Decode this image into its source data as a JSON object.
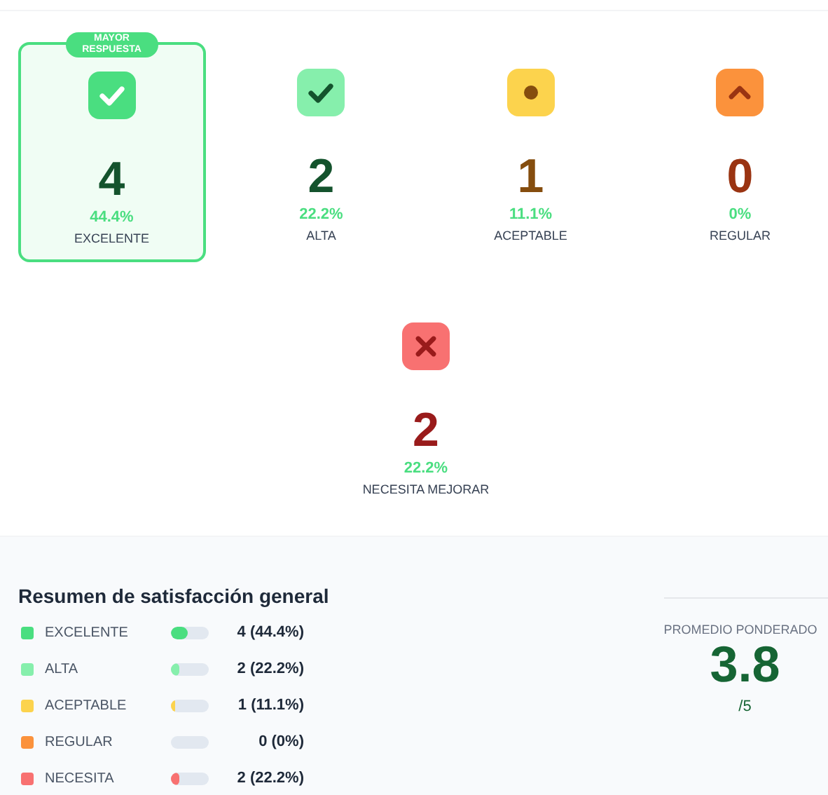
{
  "cards": [
    {
      "kind": "check",
      "color": "#4ade80",
      "count": "4",
      "percent": "44.4%",
      "label": "EXCELENTE",
      "highlighted": true,
      "badge": "MAYOR RESPUESTA"
    },
    {
      "kind": "check_soft",
      "color": "#86efac",
      "count": "2",
      "percent": "22.2%",
      "label": "ALTA",
      "highlighted": false
    },
    {
      "kind": "dot",
      "color": "#fcd34d",
      "count": "1",
      "percent": "11.1%",
      "label": "ACEPTABLE",
      "highlighted": false
    },
    {
      "kind": "chevron",
      "color": "#fb923c",
      "count": "0",
      "percent": "0%",
      "label": "REGULAR",
      "highlighted": false
    },
    {
      "kind": "cross",
      "color": "#f87171",
      "count": "2",
      "percent": "22.2%",
      "label": "NECESITA MEJORAR",
      "highlighted": false
    }
  ],
  "summary": {
    "title": "Resumen de satisfacción general",
    "rows": [
      {
        "label": "EXCELENTE",
        "color": "#4ade80",
        "level": 0.444,
        "value": "4 (44.4%)"
      },
      {
        "label": "ALTA",
        "color": "#86efac",
        "level": 0.222,
        "value": "2 (22.2%)"
      },
      {
        "label": "ACEPTABLE",
        "color": "#fcd34d",
        "level": 0.111,
        "value": "1 (11.1%)"
      },
      {
        "label": "REGULAR",
        "color": "#fb923c",
        "level": 0,
        "value": "0 (0%)"
      },
      {
        "label": "NECESITA",
        "color": "#f87171",
        "level": 0.222,
        "value": "2 (22.2%)"
      }
    ]
  },
  "average": {
    "label": "PROMEDIO PONDERADO",
    "value": "3.8",
    "scale": "/5"
  }
}
